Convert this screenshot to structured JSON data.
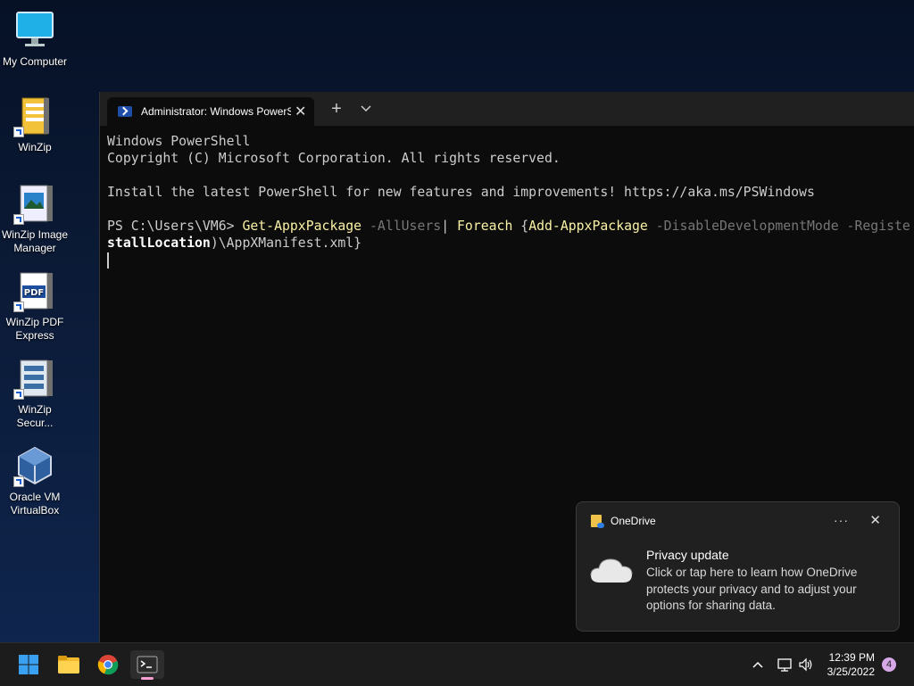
{
  "desktop": {
    "icons": [
      {
        "label": "My Computer",
        "icon": "monitor-icon"
      },
      {
        "label": "WinZip",
        "icon": "winzip-icon"
      },
      {
        "label": "WinZip Image Manager",
        "icon": "winzip-image-manager-icon"
      },
      {
        "label": "WinZip PDF Express",
        "icon": "winzip-pdf-icon"
      },
      {
        "label": "WinZip Secur...",
        "icon": "winzip-secure-icon"
      },
      {
        "label": "Oracle VM VirtualBox",
        "icon": "virtualbox-icon"
      }
    ]
  },
  "terminal": {
    "tab_title": "Administrator: Windows PowerS",
    "close_glyph": "✕",
    "new_tab_glyph": "+",
    "dropdown_glyph": "⌄",
    "lines": {
      "l1": "Windows PowerShell",
      "l2": "Copyright (C) Microsoft Corporation. All rights reserved.",
      "l4": "Install the latest PowerShell for new features and improvements! https://aka.ms/PSWindows",
      "prompt": "PS C:\\Users\\VM6> ",
      "cmd1": "Get-AppxPackage",
      "param1": " -AllUsers",
      "pipe": "| ",
      "cmd2": "Foreach",
      "brace_open": " {",
      "cmd3": "Add-AppxPackage",
      "param2": " -DisableDevelopmentMode -Registe",
      "wrap_bold": "stallLocation",
      "wrap_rest": ")\\AppXManifest.xml}"
    }
  },
  "toast": {
    "app": "OneDrive",
    "more_glyph": "···",
    "close_glyph": "✕",
    "heading": "Privacy update",
    "body": "Click or tap here to learn how OneDrive protects your privacy and to adjust your options for sharing data."
  },
  "taskbar": {
    "apps": [
      "start-icon",
      "file-explorer-icon",
      "chrome-icon",
      "terminal-icon"
    ],
    "time": "12:39 PM",
    "date": "3/25/2022",
    "notification_count": "4"
  }
}
